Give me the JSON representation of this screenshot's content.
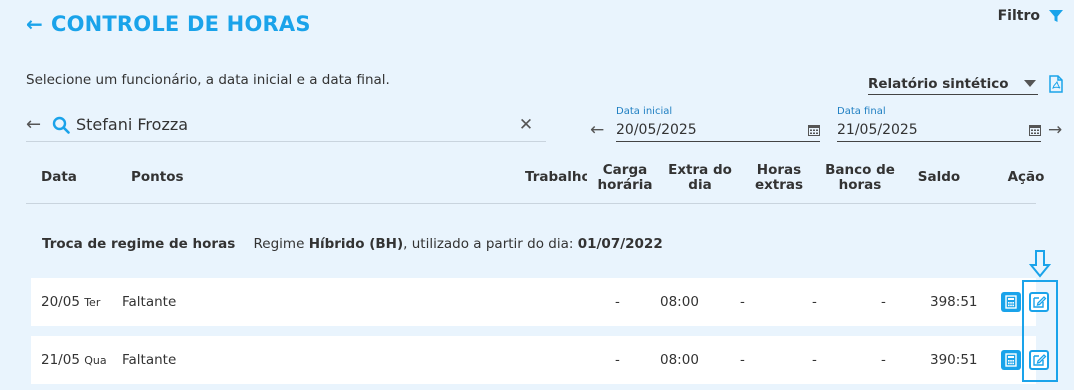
{
  "page": {
    "title": "CONTROLE DE HORAS",
    "filter_label": "Filtro",
    "instruction": "Selecione um funcionário, a data inicial e a data final.",
    "report_type": "Relatório sintético"
  },
  "employee": {
    "name": "Stefani Frozza",
    "clear": "✕"
  },
  "dates": {
    "start_label": "Data inicial",
    "start_value": "20/05/2025",
    "end_label": "Data final",
    "end_value": "21/05/2025"
  },
  "table": {
    "headers": {
      "data": "Data",
      "pontos": "Pontos",
      "trabalho": "Trabalho",
      "carga_1": "Carga",
      "carga_2": "horária",
      "extra_1": "Extra do",
      "extra_2": "dia",
      "horas_1": "Horas",
      "horas_2": "extras",
      "banco_1": "Banco de",
      "banco_2": "horas",
      "saldo": "Saldo",
      "acao": "Ação"
    },
    "regime": {
      "label": "Troca de regime de horas",
      "prefix": "Regime ",
      "name": "Híbrido (BH)",
      "middle": ", utilizado a partir do dia: ",
      "date": "01/07/2022"
    },
    "rows": [
      {
        "date": "20/05",
        "weekday": "Ter",
        "pontos": "Faltante",
        "trabalho": "-",
        "carga": "08:00",
        "extra": "-",
        "horas_extras": "-",
        "banco": "-",
        "saldo": "398:51"
      },
      {
        "date": "21/05",
        "weekday": "Qua",
        "pontos": "Faltante",
        "trabalho": "-",
        "carga": "08:00",
        "extra": "-",
        "horas_extras": "-",
        "banco": "-",
        "saldo": "390:51"
      }
    ]
  },
  "colors": {
    "accent": "#1aa3ea",
    "background": "#e9f4fd"
  },
  "icons": [
    "back-arrow-icon",
    "filter-icon",
    "pdf-icon",
    "search-icon",
    "calendar-icon",
    "calculator-icon",
    "edit-icon"
  ]
}
